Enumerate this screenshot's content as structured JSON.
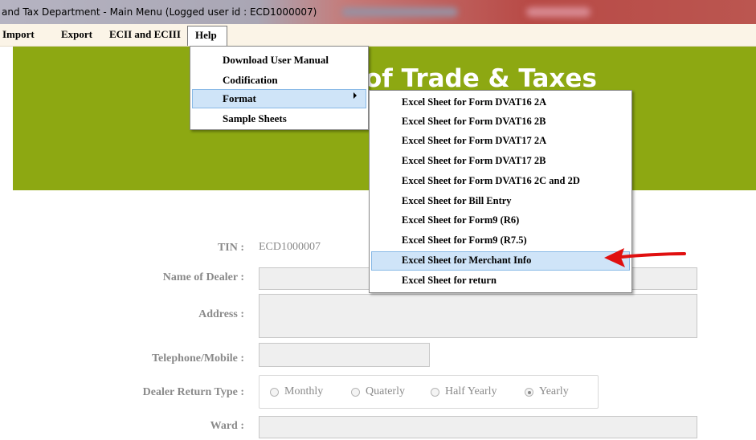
{
  "window": {
    "title": "and Tax Department - Main Menu (Logged user id : ECD1000007)"
  },
  "menubar": {
    "items": [
      "Import",
      "Export",
      "ECII and ECIII"
    ],
    "help_label": "Help"
  },
  "banner": {
    "title": "of Trade & Taxes"
  },
  "help_menu": {
    "items": [
      {
        "label": "Download User Manual"
      },
      {
        "label": "Codification"
      },
      {
        "label": "Format"
      },
      {
        "label": "Sample Sheets"
      }
    ],
    "highlighted_index": 2
  },
  "format_submenu": {
    "items": [
      {
        "label": "Excel Sheet for Form DVAT16 2A"
      },
      {
        "label": "Excel Sheet for Form DVAT16 2B"
      },
      {
        "label": "Excel Sheet for Form DVAT17 2A"
      },
      {
        "label": "Excel Sheet for Form DVAT17 2B"
      },
      {
        "label": "Excel Sheet for Form DVAT16 2C and 2D"
      },
      {
        "label": "Excel Sheet for Bill Entry"
      },
      {
        "label": "Excel Sheet for Form9 (R6)"
      },
      {
        "label": "Excel Sheet for Form9 (R7.5)"
      },
      {
        "label": "Excel Sheet for Merchant Info"
      },
      {
        "label": "Excel Sheet for return"
      }
    ],
    "highlighted_index": 8
  },
  "form": {
    "tin_label": "TIN :",
    "tin_value": "ECD1000007",
    "dealer_name_label": "Name of Dealer :",
    "dealer_name_value": "",
    "address_label": "Address :",
    "address_value": "",
    "phone_label": "Telephone/Mobile :",
    "phone_value": "",
    "return_type_label": "Dealer Return Type :",
    "return_type_options": [
      "Monthly",
      "Quaterly",
      "Half Yearly",
      "Yearly"
    ],
    "return_type_selected": "Yearly",
    "ward_label": "Ward :",
    "ward_value": ""
  },
  "colors": {
    "banner": "#8da812",
    "highlight": "#cfe4f8",
    "annotation_arrow": "#e01010"
  }
}
